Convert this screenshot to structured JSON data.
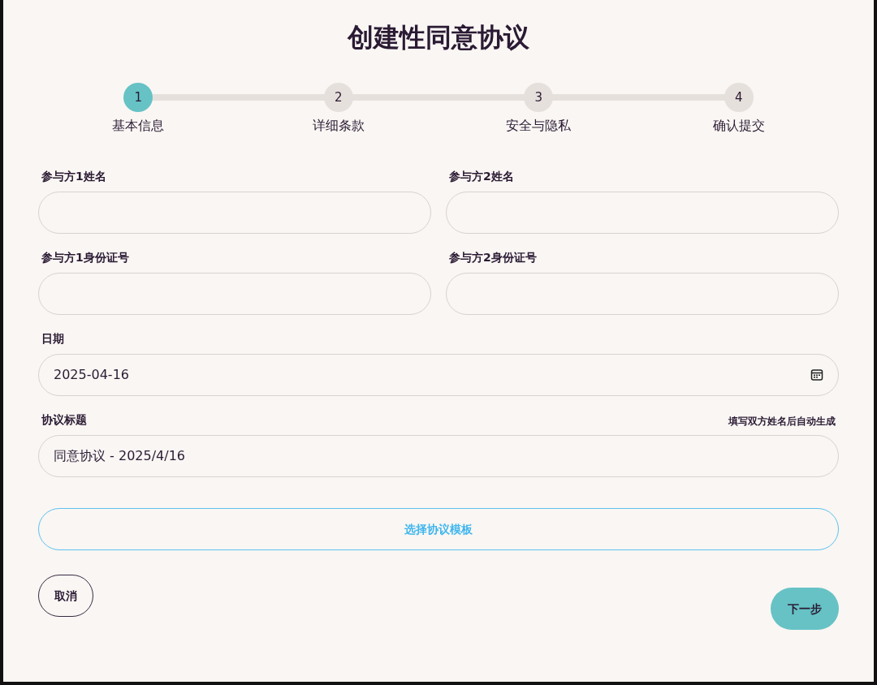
{
  "title": "创建性同意协议",
  "steps": [
    {
      "number": "1",
      "label": "基本信息",
      "selected": true
    },
    {
      "number": "2",
      "label": "详细条款",
      "selected": false
    },
    {
      "number": "3",
      "label": "安全与隐私",
      "selected": false
    },
    {
      "number": "4",
      "label": "确认提交",
      "selected": false
    }
  ],
  "fields": [
    {
      "kind": "text",
      "label": "参与方1姓名"
    },
    {
      "kind": "text",
      "label": "参与方2姓名"
    },
    {
      "kind": "text",
      "label": "参与方1身份证号"
    },
    {
      "kind": "text",
      "label": "参与方2身份证号"
    },
    {
      "kind": "date",
      "label": "日期",
      "value": "2025-04-16"
    },
    {
      "kind": "text",
      "label": "协议标题",
      "hint": "填写双方姓名后自动生成",
      "value": "同意协议 - 2025/4/16"
    }
  ],
  "template_button": "选择协议模板",
  "buttons": {
    "cancel": "取消",
    "next": "下一步"
  }
}
